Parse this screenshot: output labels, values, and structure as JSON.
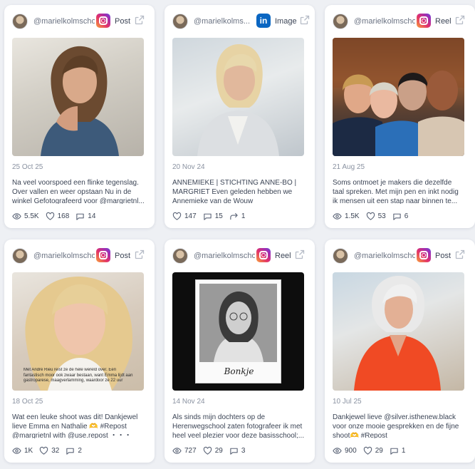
{
  "cards": [
    {
      "handle": "@marielkolmschot",
      "platform": "instagram",
      "type": "Post",
      "date": "25 Oct 25",
      "caption": "Na veel voorspoed een flinke tegenslag. Over vallen en weer opstaan Nu in de winkel Gefotografeerd voor @margrietnl...",
      "stats": [
        {
          "icon": "eye-icon",
          "value": "5.5K"
        },
        {
          "icon": "heart-icon",
          "value": "168"
        },
        {
          "icon": "comment-icon",
          "value": "14"
        }
      ]
    },
    {
      "handle": "@marielkolms...",
      "platform": "linkedin",
      "type": "Image",
      "date": "20 Nov 24",
      "caption": "ANNEMIEKE | STICHTING ANNE-BO | MARGRIET Even geleden hebben we Annemieke van de Wouw gefotografeerd...",
      "stats": [
        {
          "icon": "heart-icon",
          "value": "147"
        },
        {
          "icon": "comment-icon",
          "value": "15"
        },
        {
          "icon": "share-icon",
          "value": "1"
        }
      ]
    },
    {
      "handle": "@marielkolmschot",
      "platform": "instagram",
      "type": "Reel",
      "date": "21 Aug 25",
      "caption": "Soms ontmoet je makers die dezelfde taal spreken. Met mijn pen en inkt nodig ik mensen uit een stap naar binnen te...",
      "stats": [
        {
          "icon": "eye-icon",
          "value": "1.5K"
        },
        {
          "icon": "heart-icon",
          "value": "53"
        },
        {
          "icon": "comment-icon",
          "value": "6"
        }
      ]
    },
    {
      "handle": "@marielkolmschot",
      "platform": "instagram",
      "type": "Post",
      "date": "18 Oct 25",
      "caption": "Wat een leuke shoot was dit! Dankjewel lieve Emma en Nathalie 🫶 #Repost @margrietnl with @use.repost ・・・ Met...",
      "overlay": "Met André Rieu reist ze de hele wereld over. Een fantastisch moor ook zwaar bestaan, want Emma lijdt aan gastroparese, maagverlamming, waardoor ze 22 uur",
      "stats": [
        {
          "icon": "eye-icon",
          "value": "1K"
        },
        {
          "icon": "heart-icon",
          "value": "32"
        },
        {
          "icon": "comment-icon",
          "value": "2"
        }
      ]
    },
    {
      "handle": "@marielkolmschot",
      "platform": "instagram",
      "type": "Reel",
      "date": "14 Nov 24",
      "caption": "Als sinds mijn dochters op de Herenwegschool zaten fotografeer ik met heel veel plezier voor deze basisschool;...",
      "overlay": "Bonkje",
      "stats": [
        {
          "icon": "eye-icon",
          "value": "727"
        },
        {
          "icon": "heart-icon",
          "value": "29"
        },
        {
          "icon": "comment-icon",
          "value": "3"
        }
      ]
    },
    {
      "handle": "@marielkolmschot",
      "platform": "instagram",
      "type": "Post",
      "date": "10 Jul 25",
      "caption": "Dankjewel lieve @silver.isthenew.black voor onze mooie gesprekken en de fijne shoot🫶 #Repost @silver.isthenew.black...",
      "stats": [
        {
          "icon": "eye-icon",
          "value": "900"
        },
        {
          "icon": "heart-icon",
          "value": "29"
        },
        {
          "icon": "comment-icon",
          "value": "1"
        }
      ]
    }
  ]
}
